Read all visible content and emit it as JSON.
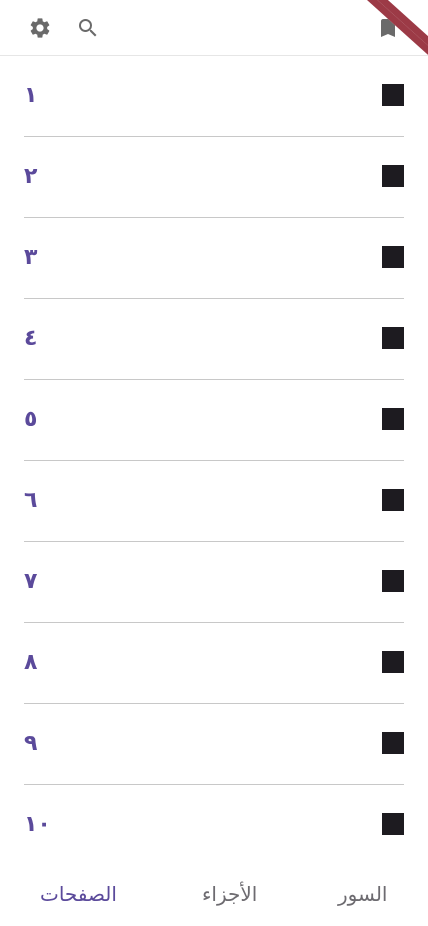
{
  "topbar": {
    "icons": {
      "settings": "gear-icon",
      "search": "search-icon",
      "bookmark": "bookmark-icon"
    }
  },
  "pages": [
    {
      "label": "١"
    },
    {
      "label": "٢"
    },
    {
      "label": "٣"
    },
    {
      "label": "٤"
    },
    {
      "label": "٥"
    },
    {
      "label": "٦"
    },
    {
      "label": "٧"
    },
    {
      "label": "٨"
    },
    {
      "label": "٩"
    },
    {
      "label": "١٠"
    }
  ],
  "bottom_nav": {
    "pages_label": "الصفحات",
    "juz_label": "الأجزاء",
    "surah_label": "السور",
    "active": "pages"
  },
  "colors": {
    "accent": "#5b4a9b",
    "ribbon": "#9c3a46",
    "square": "#1d1b20",
    "inactive_tab": "#6d6b70"
  }
}
